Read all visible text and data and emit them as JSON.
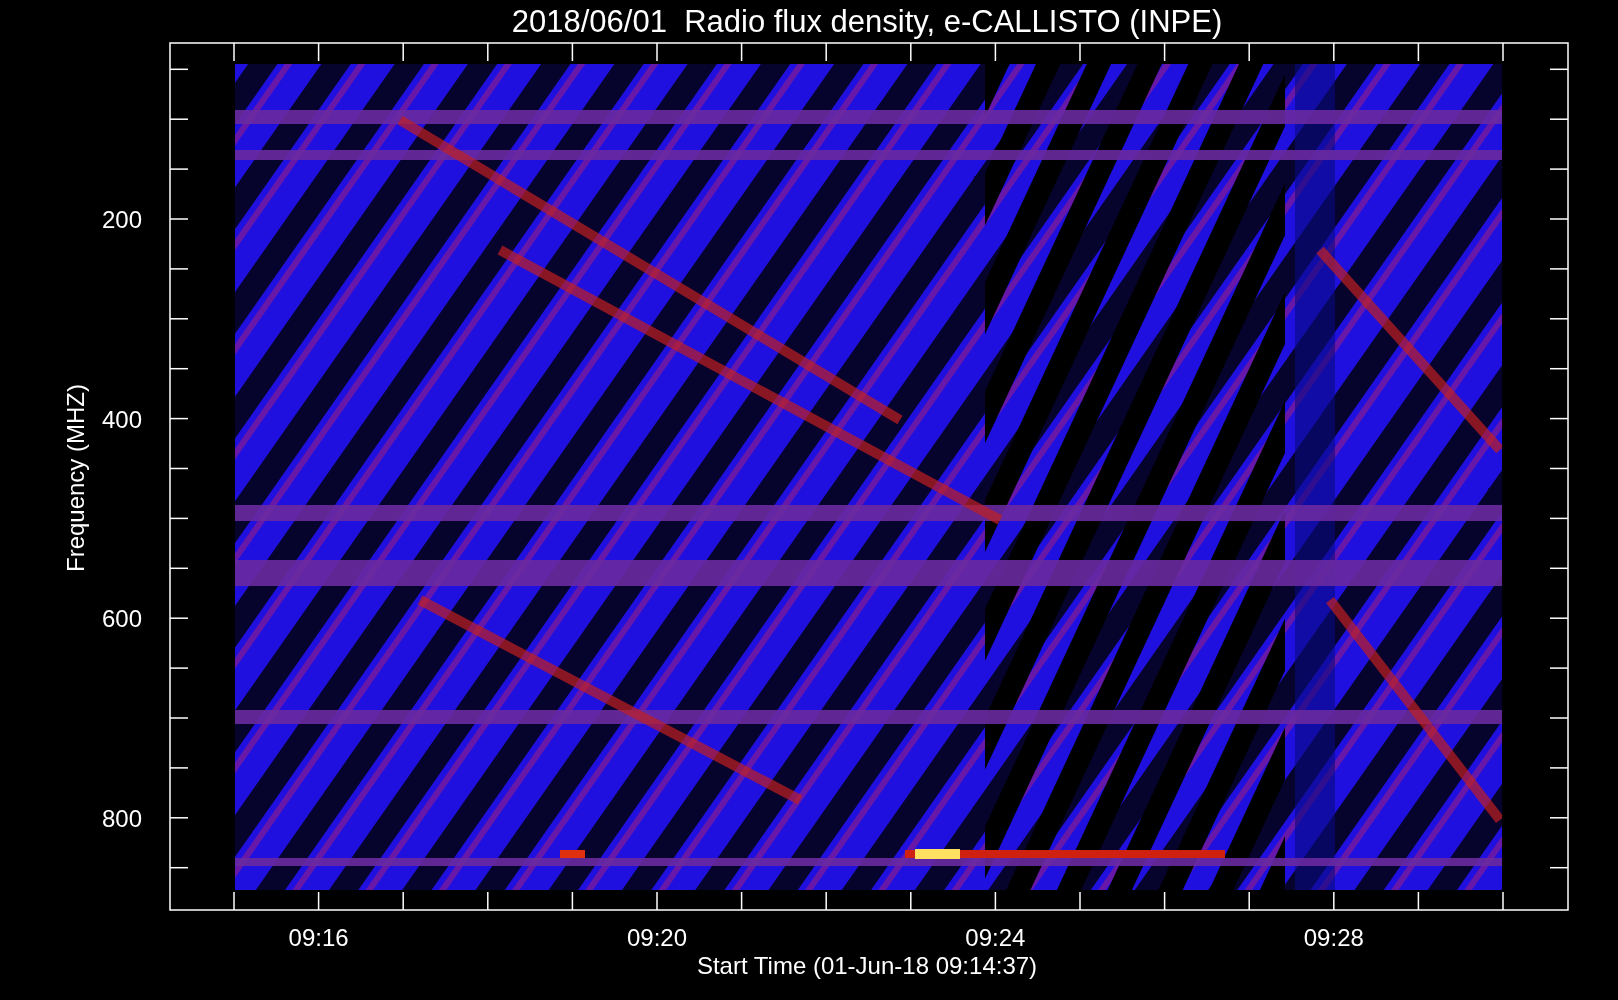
{
  "title": "2018/06/01  Radio flux density, e-CALLISTO (INPE)",
  "y_axis": {
    "label": "Frequency (MHZ)",
    "ticks": [
      "200",
      "400",
      "600",
      "800"
    ]
  },
  "x_axis": {
    "label": "Start Time (01-Jun-18 09:14:37)",
    "ticks": [
      "09:16",
      "09:20",
      "09:24",
      "09:28"
    ]
  }
}
